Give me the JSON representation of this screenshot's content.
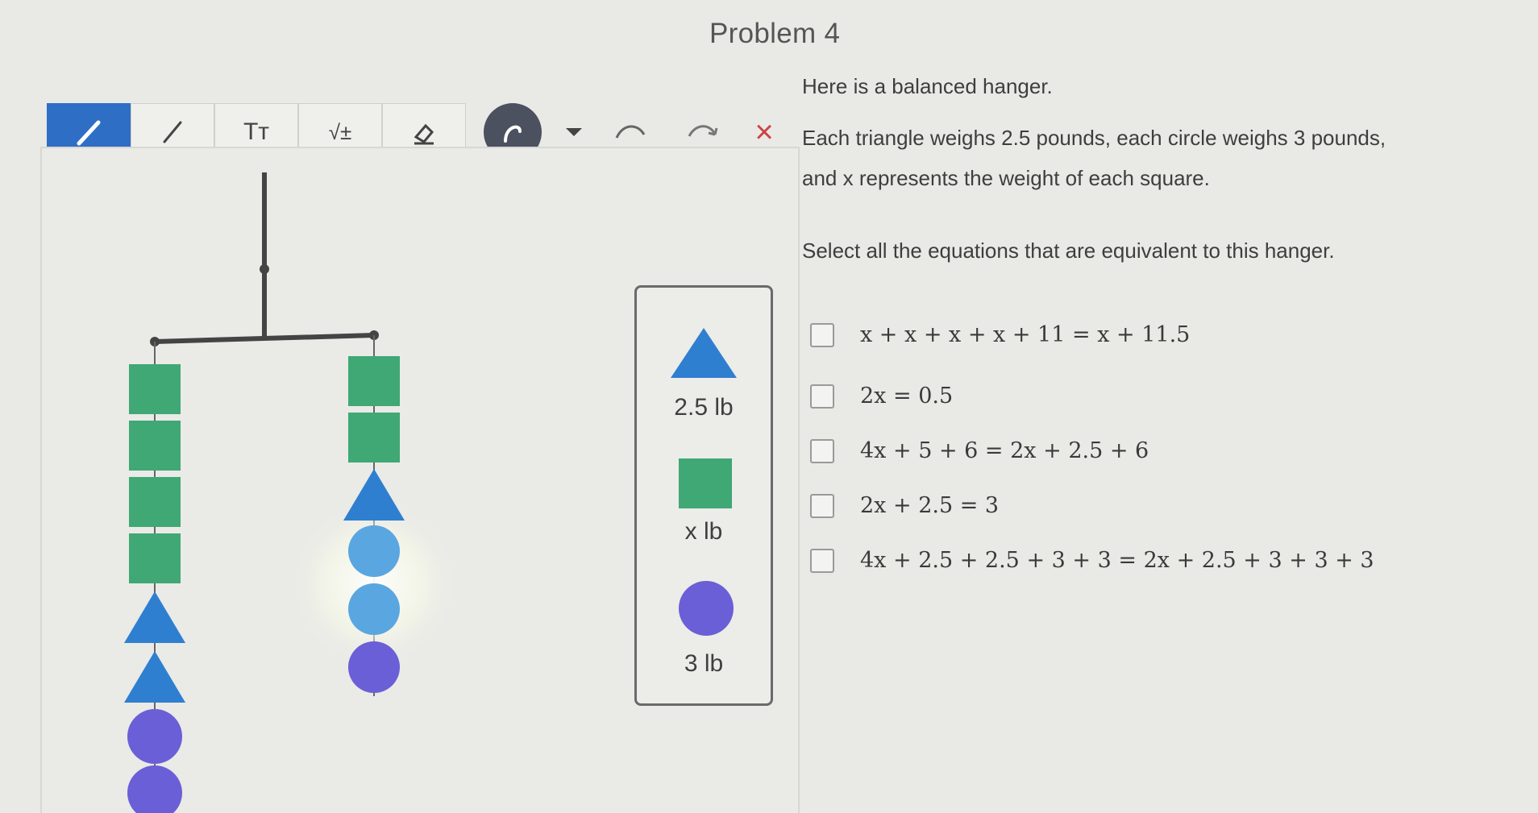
{
  "page": {
    "title": "Problem 4"
  },
  "toolbar": {
    "pen_icon": "pen-icon",
    "line_icon": "line-icon",
    "text_label": "Tт",
    "math_label": "√±",
    "eraser_icon": "eraser-icon",
    "lasso_icon": "lasso-icon",
    "undo_icon": "undo-icon",
    "redo_icon": "redo-icon",
    "clear_label": "×"
  },
  "legend": {
    "triangle_label": "2.5 lb",
    "square_label": "x lb",
    "circle_label": "3 lb"
  },
  "question": {
    "line1": "Here is a balanced hanger.",
    "line2": "Each triangle weighs 2.5 pounds, each circle weighs 3 pounds,",
    "line3": "and x represents the weight of each square.",
    "line4": "Select all the equations that are equivalent to this hanger."
  },
  "choices": [
    {
      "equation": "x + x + x + x + 11 = x + 11.5"
    },
    {
      "equation": "2x = 0.5"
    },
    {
      "equation": "4x + 5 + 6 = 2x + 2.5 + 6"
    },
    {
      "equation": "2x + 2.5 = 3"
    },
    {
      "equation": "4x + 2.5 + 2.5 + 3 + 3 = 2x + 2.5 + 3 + 3 + 3"
    }
  ],
  "colors": {
    "square": "#3fa874",
    "triangle": "#2f7fd0",
    "circle_light": "#5aa6e0",
    "circle_purple": "#6a5fd6",
    "accent": "#2f6ec5"
  }
}
